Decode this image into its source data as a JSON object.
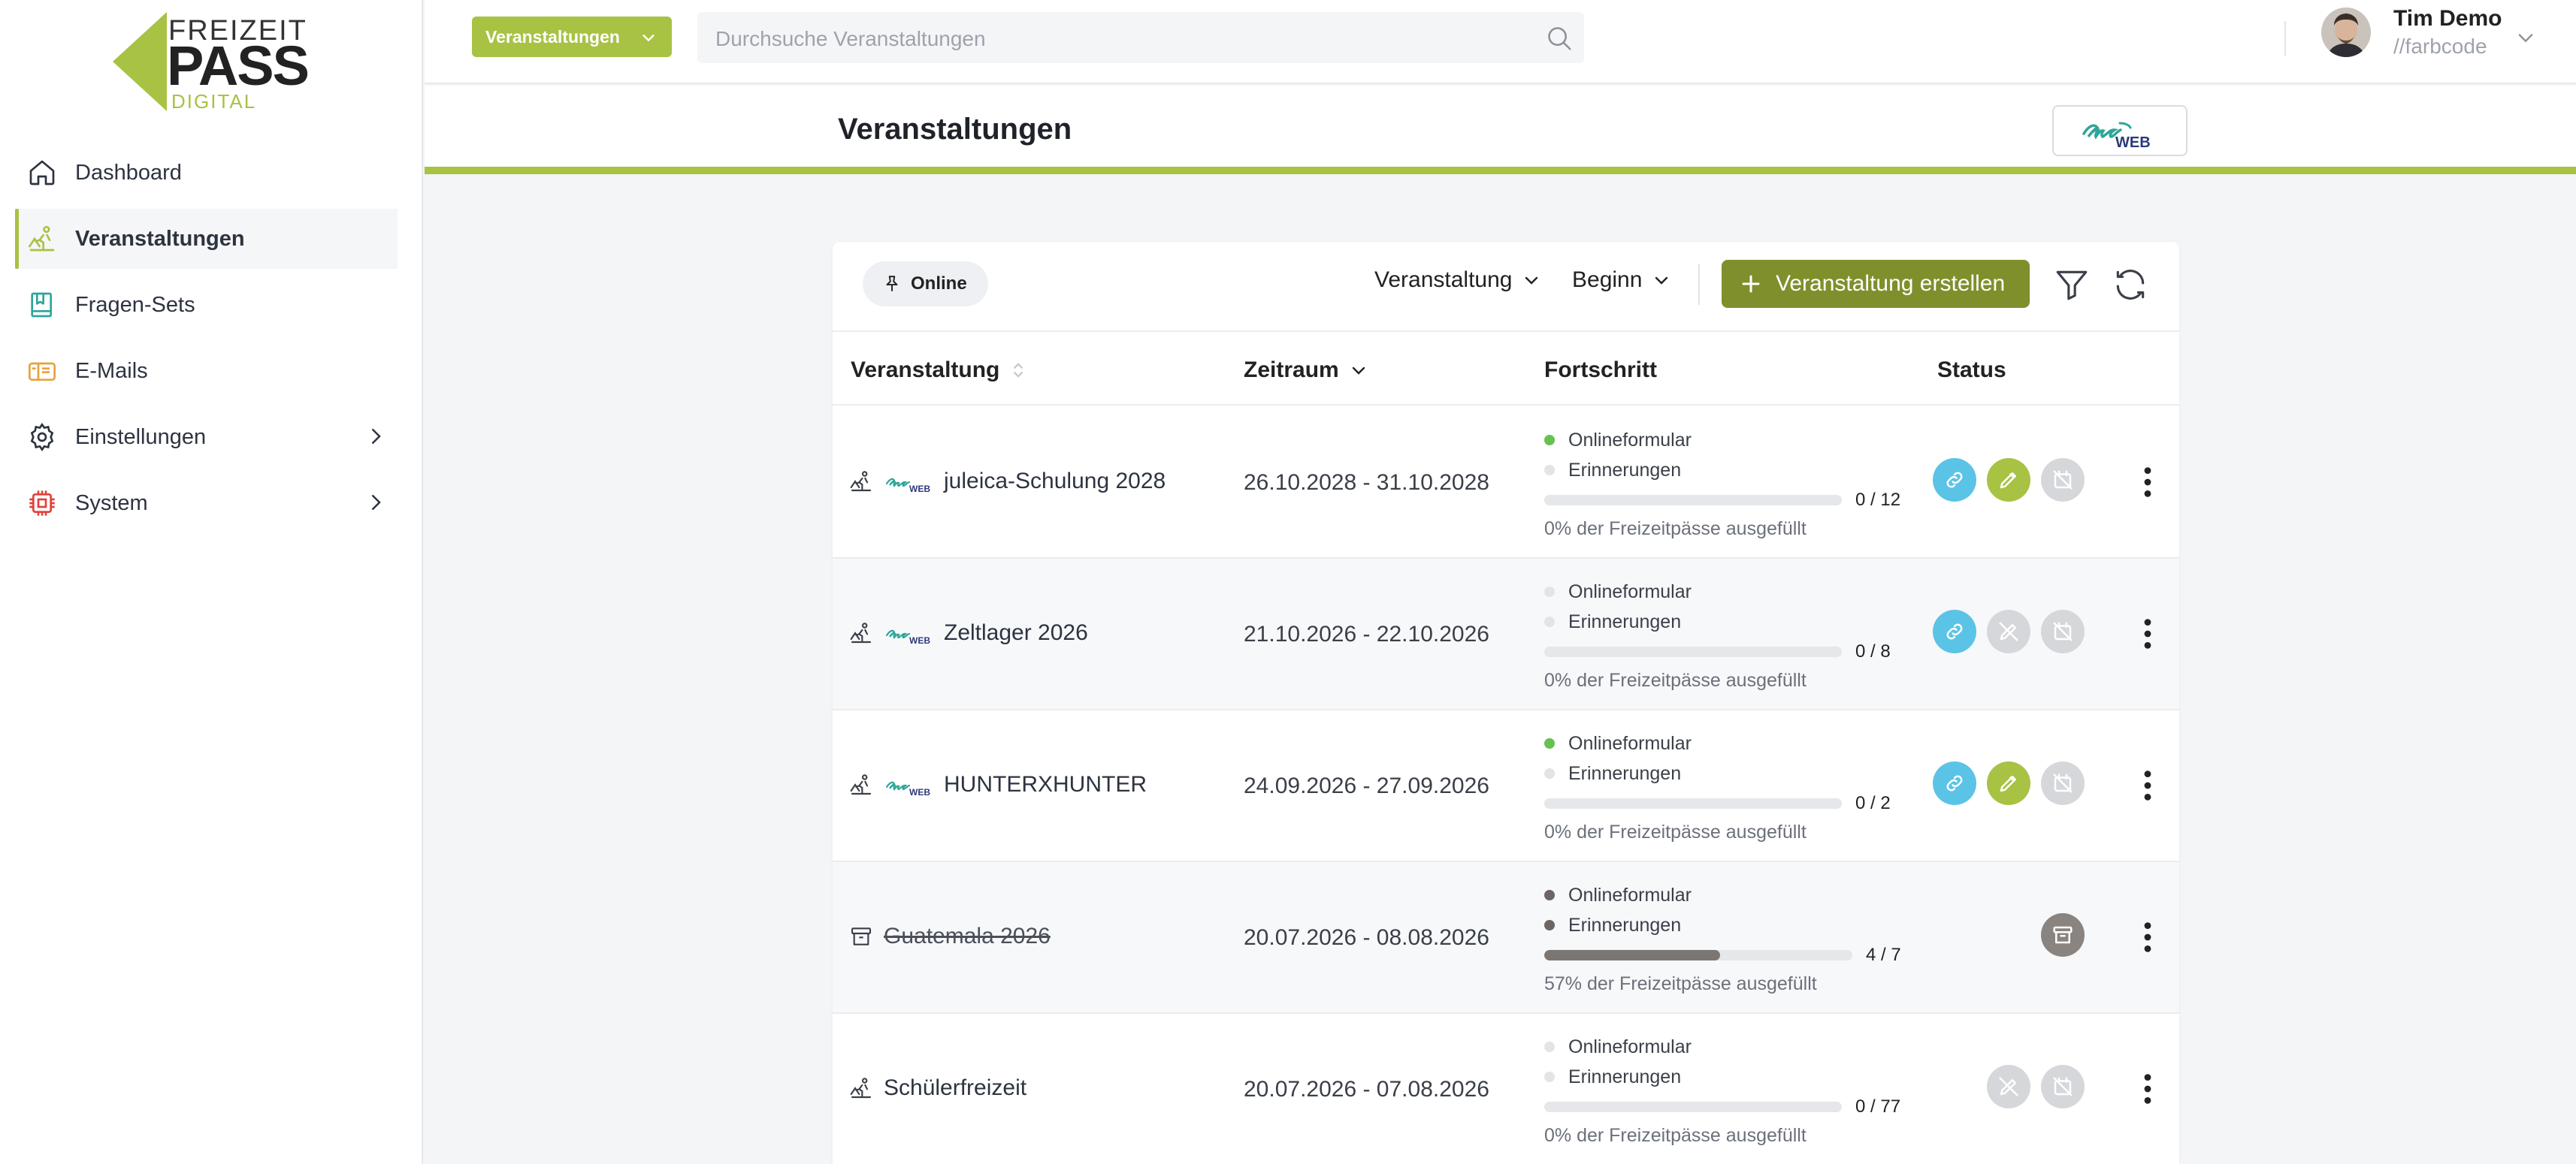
{
  "brand": {
    "line1": "FREIZEIT",
    "line2": "PASS",
    "line3": "DIGITAL",
    "accent": "#a8c244"
  },
  "sidebar": {
    "items": [
      {
        "label": "Dashboard",
        "icon": "home-icon",
        "active": false
      },
      {
        "label": "Veranstaltungen",
        "icon": "events-icon",
        "active": true
      },
      {
        "label": "Fragen-Sets",
        "icon": "book-icon",
        "active": false
      },
      {
        "label": "E-Mails",
        "icon": "mail-icon",
        "active": false
      },
      {
        "label": "Einstellungen",
        "icon": "gear-icon",
        "active": false,
        "expandable": true
      },
      {
        "label": "System",
        "icon": "chip-icon",
        "active": false,
        "expandable": true
      }
    ]
  },
  "header": {
    "scope_label": "Veranstaltungen",
    "search_placeholder": "Durchsuche Veranstaltungen",
    "user_name": "Tim Demo",
    "user_org": "//farbcode"
  },
  "page": {
    "title": "Veranstaltungen"
  },
  "toolbar": {
    "filter_chip": "Online",
    "sort1": "Veranstaltung",
    "sort2": "Beginn",
    "create_label": "Veranstaltung erstellen",
    "create_color": "#7f8f2c"
  },
  "table": {
    "columns": [
      "Veranstaltung",
      "Zeitraum",
      "Fortschritt",
      "Status"
    ],
    "progress_labels": {
      "online": "Onlineformular",
      "reminders": "Erinnerungen"
    },
    "rows": [
      {
        "name": "juleica-Schulung 2028",
        "amos": true,
        "archived": false,
        "date": "26.10.2028 - 31.10.2028",
        "online_on": true,
        "reminders_on": false,
        "count": "0 / 12",
        "fraction": 0,
        "pct_text": "0% der Freizeitpässe ausgefüllt",
        "status": [
          "link",
          "edit",
          "calendar-off"
        ]
      },
      {
        "name": "Zeltlager 2026",
        "amos": true,
        "archived": false,
        "date": "21.10.2026 - 22.10.2026",
        "online_on": false,
        "reminders_on": false,
        "count": "0 / 8",
        "fraction": 0,
        "pct_text": "0% der Freizeitpässe ausgefüllt",
        "status": [
          "link",
          "edit-off",
          "calendar-off"
        ]
      },
      {
        "name": "HUNTERXHUNTER",
        "amos": true,
        "archived": false,
        "date": "24.09.2026 - 27.09.2026",
        "online_on": true,
        "reminders_on": false,
        "count": "0 / 2",
        "fraction": 0,
        "pct_text": "0% der Freizeitpässe ausgefüllt",
        "status": [
          "link",
          "edit",
          "calendar-off"
        ]
      },
      {
        "name": "Guatemala 2026",
        "amos": false,
        "archived": true,
        "date": "20.07.2026 - 08.08.2026",
        "online_on": "dark",
        "reminders_on": "dark",
        "count": "4 / 7",
        "fraction": 0.57,
        "pct_text": "57% der Freizeitpässe ausgefüllt",
        "status": [
          "archive"
        ]
      },
      {
        "name": "Schülerfreizeit",
        "amos": false,
        "archived": false,
        "date": "20.07.2026 - 07.08.2026",
        "online_on": false,
        "reminders_on": false,
        "count": "0 / 77",
        "fraction": 0,
        "pct_text": "0% der Freizeitpässe ausgefüllt",
        "status": [
          "edit-off",
          "calendar-off"
        ]
      }
    ]
  },
  "colors": {
    "accent": "#a8c244",
    "link_blue": "#5bc3e6",
    "dot_green": "#66c24f",
    "dot_grey": "#e3e4e7",
    "disabled": "#d6d7da"
  }
}
